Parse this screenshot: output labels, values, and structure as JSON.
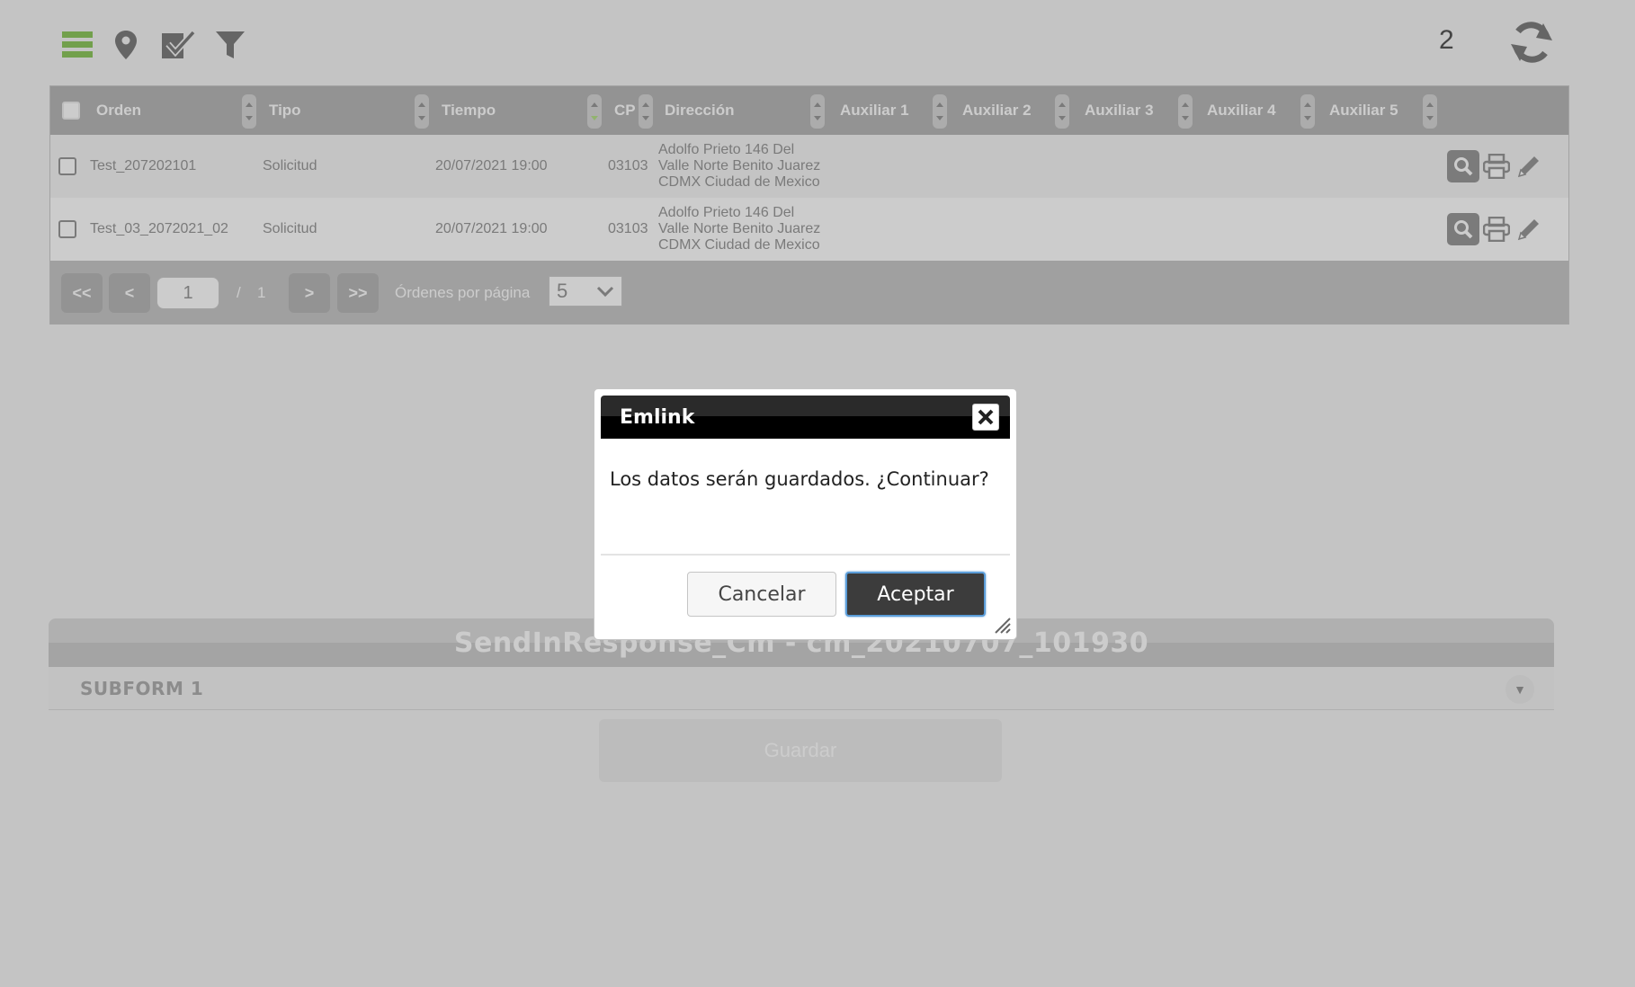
{
  "toolbar": {
    "count": "2",
    "icons": [
      "list-icon",
      "map-pin-icon",
      "checkmark-form-icon",
      "filter-icon",
      "refresh-icon"
    ]
  },
  "table": {
    "columns": [
      "Orden",
      "Tipo",
      "Tiempo",
      "CP",
      "Dirección",
      "Auxiliar 1",
      "Auxiliar 2",
      "Auxiliar 3",
      "Auxiliar 4",
      "Auxiliar 5"
    ],
    "rows": [
      {
        "orden": "Test_207202101",
        "tipo": "Solicitud",
        "tiempo": "20/07/2021 19:00",
        "cp": "03103",
        "direccion": "Adolfo Prieto 146 Del\nValle Norte Benito Juarez\nCDMX Ciudad de Mexico"
      },
      {
        "orden": "Test_03_2072021_02",
        "tipo": "Solicitud",
        "tiempo": "20/07/2021 19:00",
        "cp": "03103",
        "direccion": "Adolfo Prieto 146 Del\nValle Norte Benito Juarez\nCDMX Ciudad de Mexico"
      }
    ]
  },
  "pager": {
    "first": "<<",
    "prev": "<",
    "current_page": "1",
    "separator": "/",
    "total_pages": "1",
    "next": ">",
    "last": ">>",
    "per_page_label": "Órdenes por página",
    "per_page_value": "5"
  },
  "form": {
    "title": "SendInResponse_Cm - cm_20210707_101930",
    "subform_title": "SUBFORM 1",
    "save_label": "Guardar"
  },
  "dialog": {
    "title": "Emlink",
    "message": "Los datos serán guardados. ¿Continuar?",
    "cancel_label": "Cancelar",
    "accept_label": "Aceptar"
  },
  "colors": {
    "toolbar_accent": "#8fc85f",
    "dialog_title_bg": "#000000",
    "accept_button": "#3c3c3c",
    "focus_ring": "#5b9dd9"
  }
}
